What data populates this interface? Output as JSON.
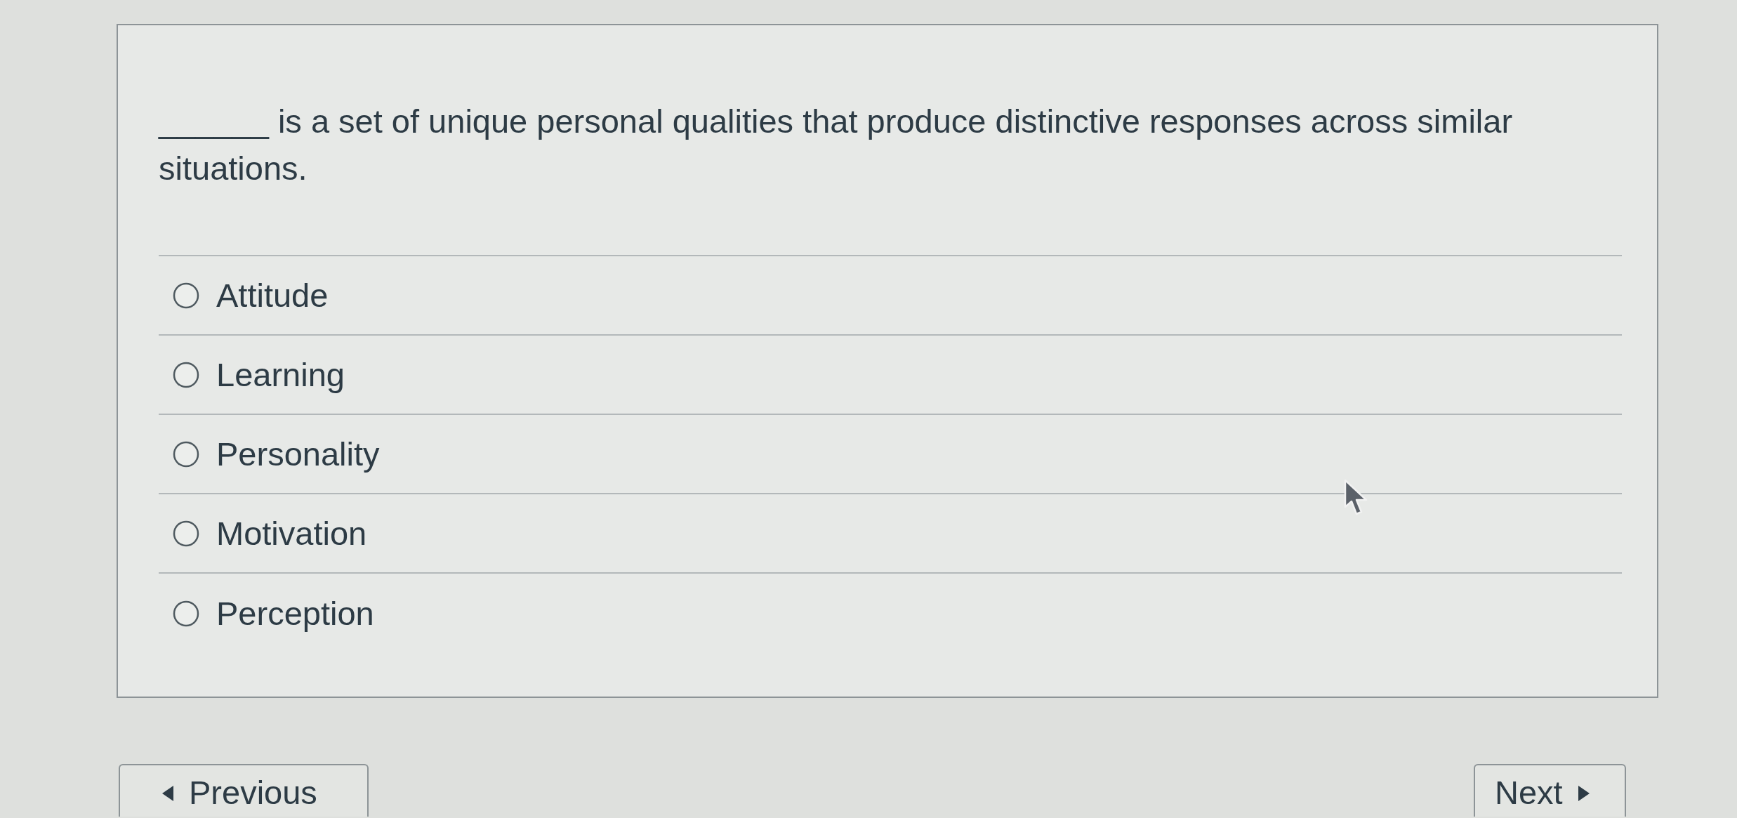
{
  "question": {
    "text": "______ is a set of unique personal qualities that produce distinctive responses across similar situations."
  },
  "options": [
    {
      "label": "Attitude",
      "selected": false
    },
    {
      "label": "Learning",
      "selected": false
    },
    {
      "label": "Personality",
      "selected": false
    },
    {
      "label": "Motivation",
      "selected": false
    },
    {
      "label": "Perception",
      "selected": false
    }
  ],
  "navigation": {
    "previous": "Previous",
    "next": "Next"
  }
}
